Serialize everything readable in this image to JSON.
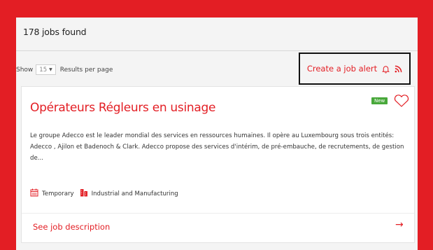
{
  "results": {
    "count_text": "178 jobs found"
  },
  "pagination": {
    "show_label": "Show",
    "per_page_value": "15",
    "per_page_suffix": "Results per page"
  },
  "job_alert": {
    "label": "Create a job alert"
  },
  "job": {
    "title": "Opérateurs Régleurs en usinage",
    "badge": "New",
    "description": "Le groupe Adecco est le leader mondial des services en ressources humaines. Il opère au Luxembourg sous trois entités: Adecco , Ajilon et Badenoch & Clark. Adecco propose des services d'intérim, de pré-embauche, de recrutements, de gestion de...",
    "contract_type": "Temporary",
    "industry": "Industrial and Manufacturing",
    "link_label": "See job description",
    "arrow": "→"
  },
  "colors": {
    "accent": "#e31e24",
    "badge": "#48a83a",
    "panel": "#f4f4f4"
  },
  "icons": [
    "bell-icon",
    "rss-icon",
    "heart-icon",
    "calendar-icon",
    "building-icon",
    "arrow-right-icon"
  ]
}
